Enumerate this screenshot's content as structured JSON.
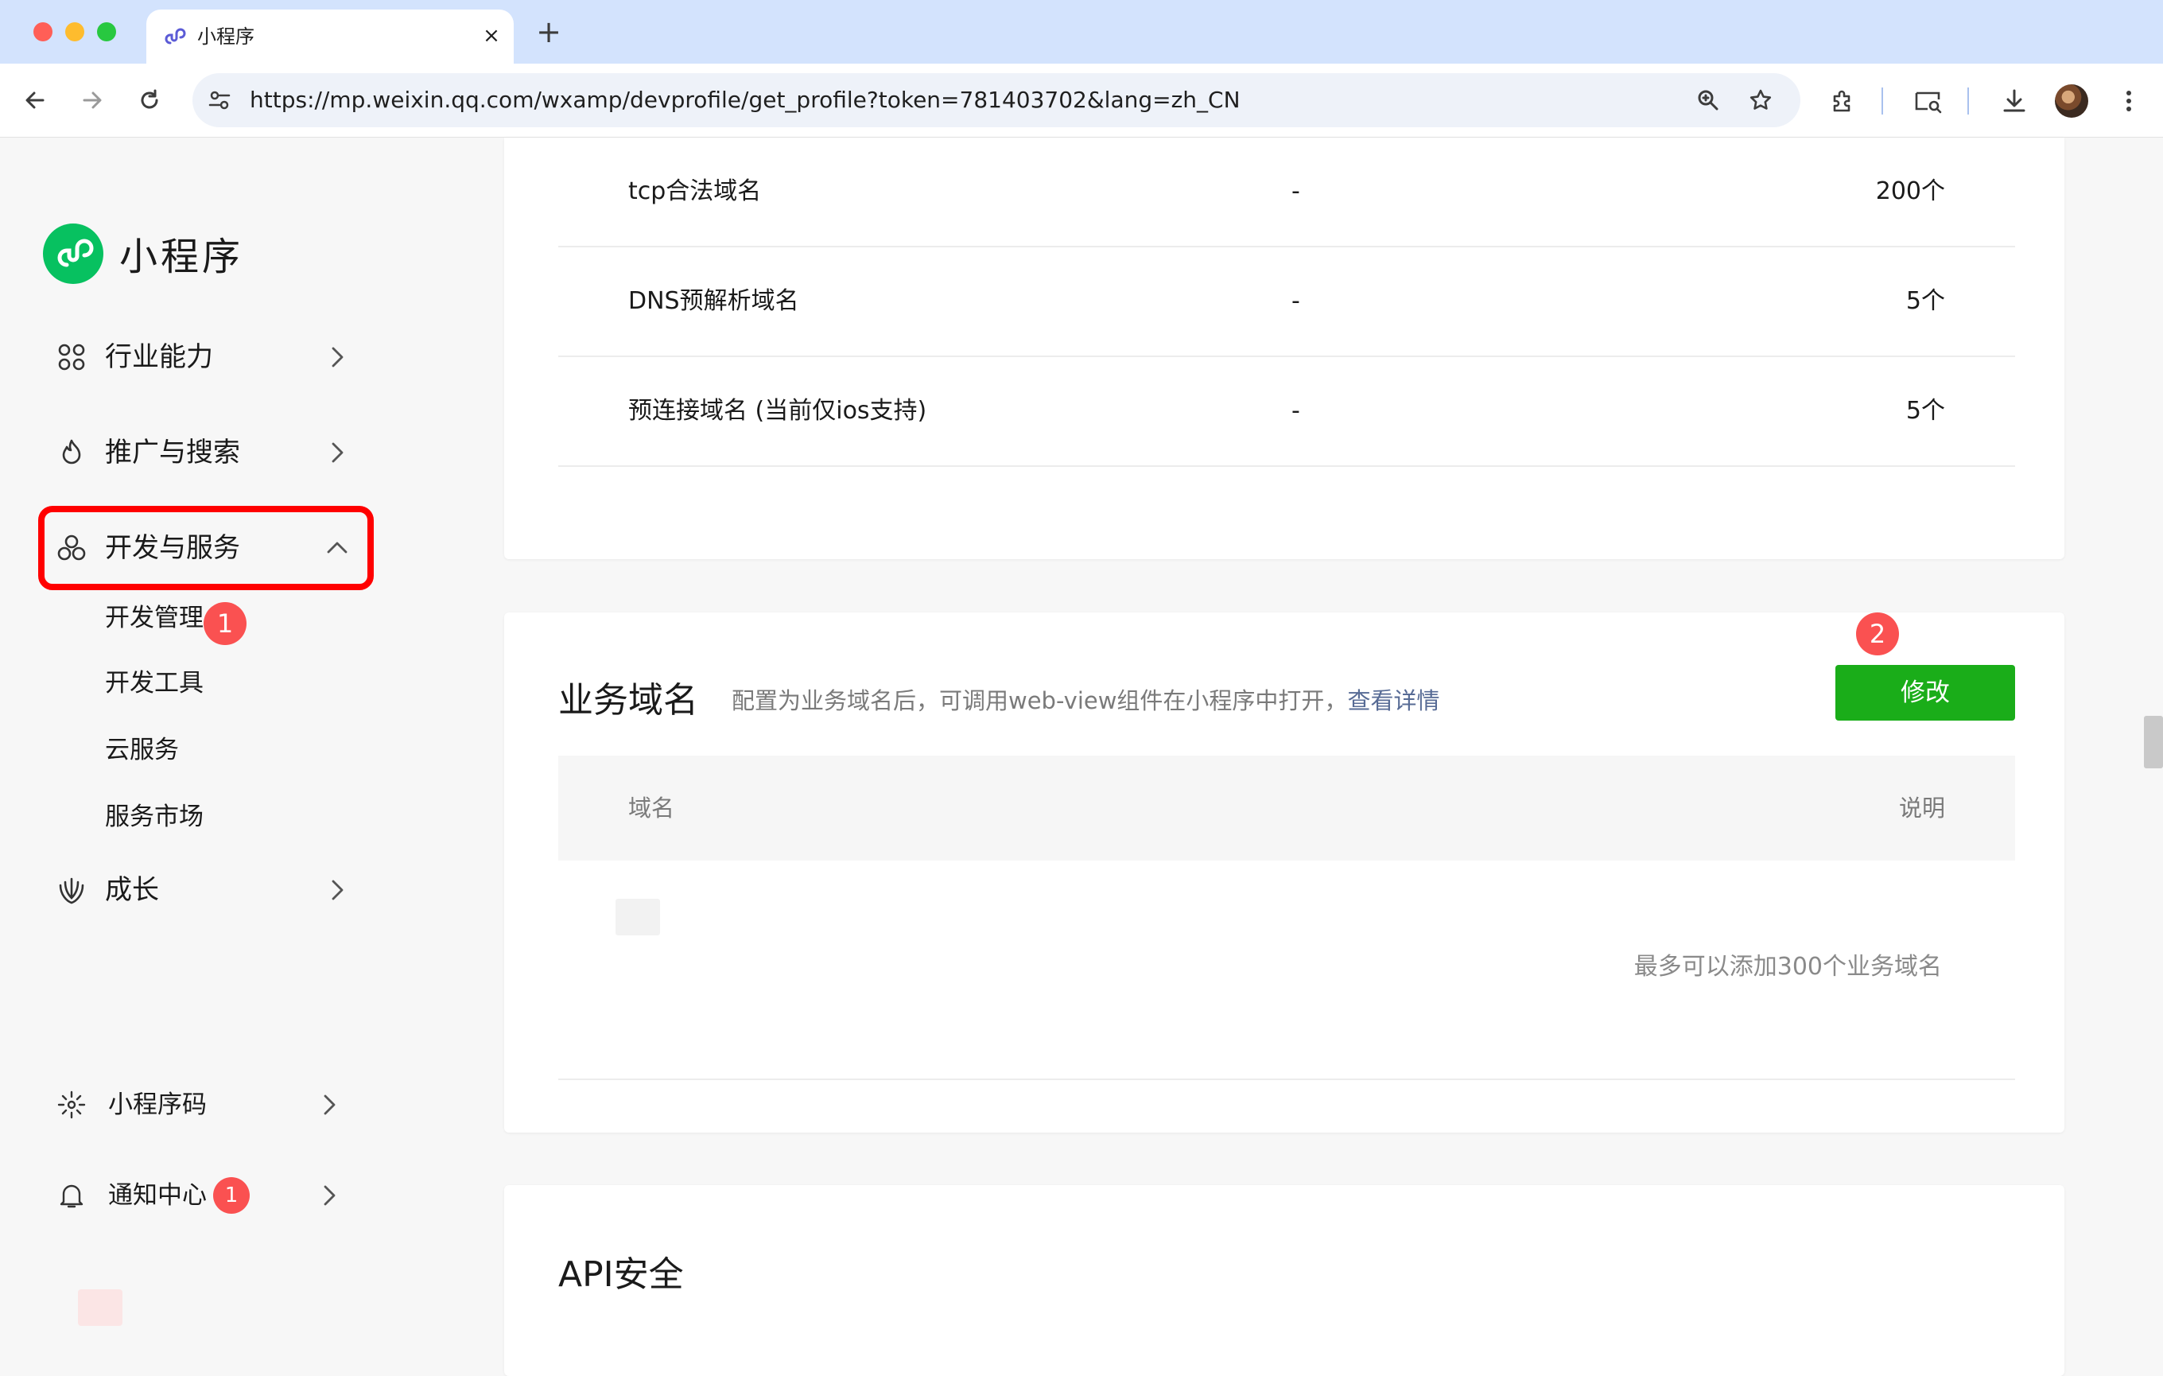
{
  "browser": {
    "tab_title": "小程序",
    "tab_close": "×",
    "new_tab": "+",
    "url": "https://mp.weixin.qq.com/wxamp/devprofile/get_profile?token=781403702&lang=zh_CN"
  },
  "sidebar": {
    "logo_text": "小程序",
    "menu": [
      {
        "label": "行业能力",
        "icon": "industry-icon"
      },
      {
        "label": "推广与搜索",
        "icon": "promotion-icon"
      },
      {
        "label": "开发与服务",
        "icon": "dev-service-icon",
        "expanded": true
      },
      {
        "label": "成长",
        "icon": "growth-icon"
      }
    ],
    "submenu": [
      {
        "label": "开发管理",
        "badge": "1"
      },
      {
        "label": "开发工具"
      },
      {
        "label": "云服务"
      },
      {
        "label": "服务市场"
      }
    ],
    "bottom": [
      {
        "label": "小程序码",
        "icon": "qrcode-icon"
      },
      {
        "label": "通知中心",
        "icon": "bell-icon",
        "badge": "1"
      }
    ]
  },
  "domains_table": {
    "rows": [
      {
        "name": "tcp合法域名",
        "value": "-",
        "limit": "200个"
      },
      {
        "name": "DNS预解析域名",
        "value": "-",
        "limit": "5个"
      },
      {
        "name": "预连接域名 (当前仅ios支持)",
        "value": "-",
        "limit": "5个"
      }
    ]
  },
  "business_domain": {
    "title": "业务域名",
    "description": "配置为业务域名后，可调用web-view组件在小程序中打开，",
    "link": "查看详情",
    "edit_button": "修改",
    "step_badge": "2",
    "col_domain": "域名",
    "col_desc": "说明",
    "limit_note": "最多可以添加300个业务域名"
  },
  "api_security": {
    "title": "API安全"
  },
  "colors": {
    "accent_green": "#1aad19",
    "badge_red": "#fa5151",
    "highlight_red": "#ff0000",
    "link_blue": "#576b95"
  }
}
